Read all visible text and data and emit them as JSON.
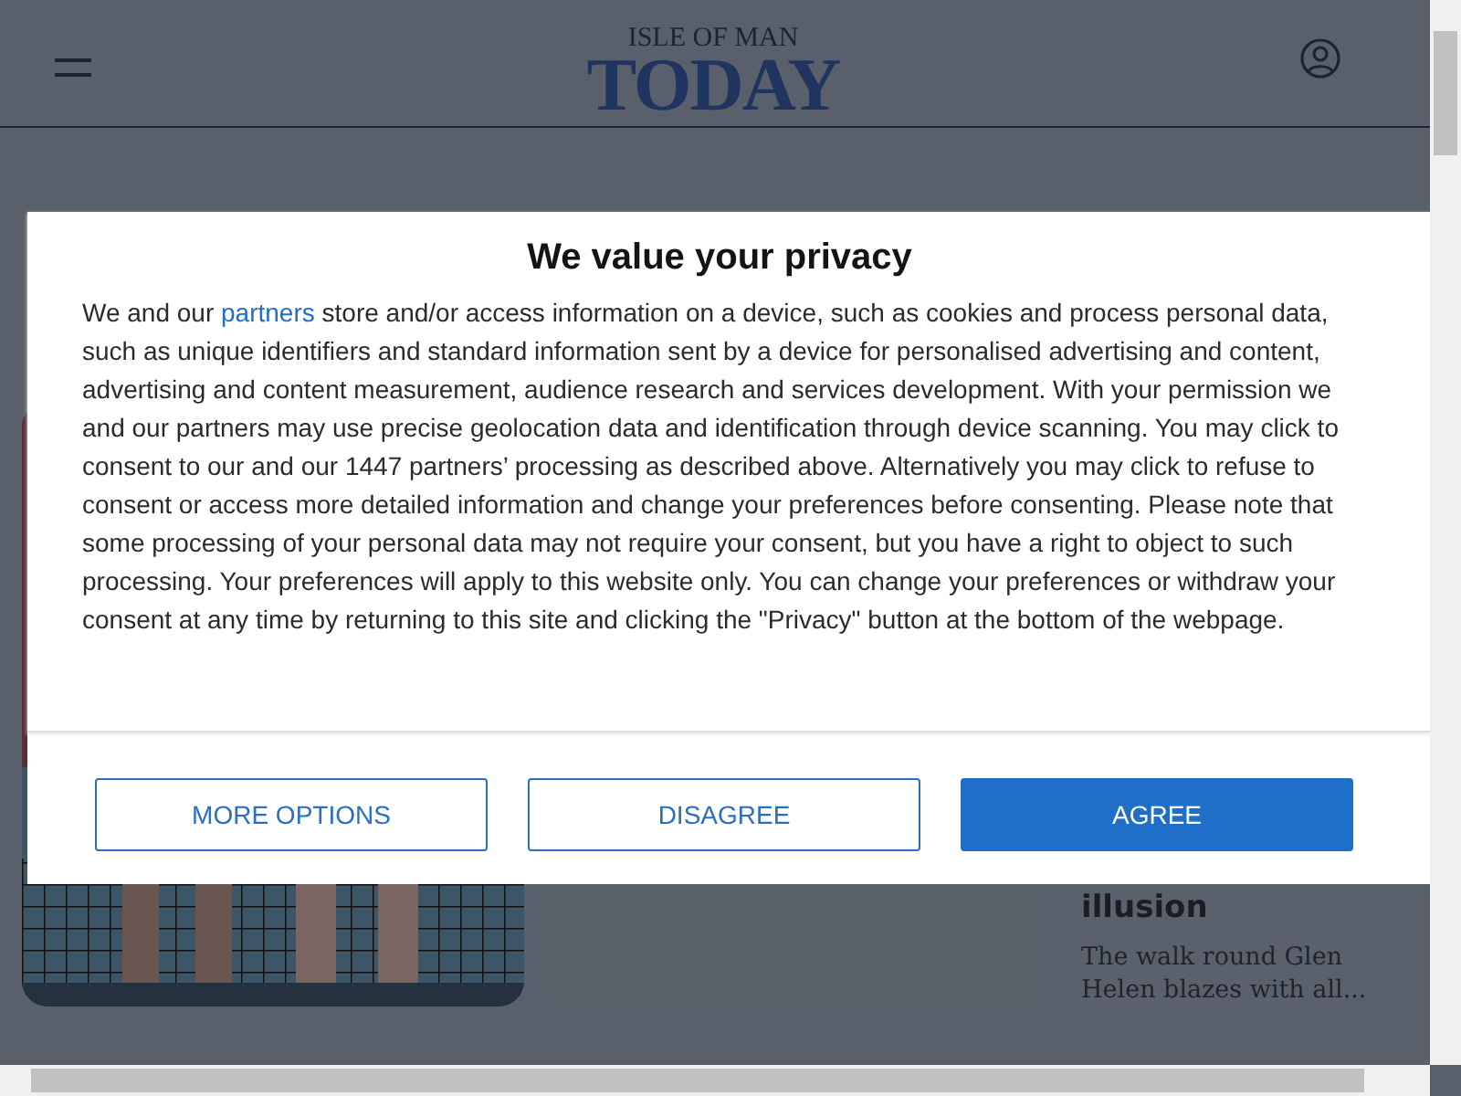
{
  "header": {
    "logo_top": "ISLE OF MAN",
    "logo_main": "TODAY"
  },
  "article": {
    "title_tail": "illusion",
    "summary": "The walk round Glen Helen blazes with all..."
  },
  "consent": {
    "title": "We value your privacy",
    "text_before": "We and our ",
    "link": "partners",
    "text_after": " store and/or access information on a device, such as cookies and process personal data, such as unique identifiers and standard information sent by a device for personalised advertising and content, advertising and content measurement, audience research and services development. With your permission we and our partners may use precise geolocation data and identification through device scanning. You may click to consent to our and our 1447 partners’ processing as described above. Alternatively you may click to refuse to consent or access more detailed information and change your preferences before consenting. Please note that some processing of your personal data may not require your consent, but you have a right to object to such processing. Your preferences will apply to this website only. You can change your preferences or withdraw your consent at any time by returning to this site and clicking the \"Privacy\" button at the bottom of the webpage.",
    "buttons": [
      {
        "label": "MORE OPTIONS",
        "kind": "outline"
      },
      {
        "label": "DISAGREE",
        "kind": "outline"
      },
      {
        "label": "AGREE",
        "kind": "primary"
      }
    ]
  }
}
